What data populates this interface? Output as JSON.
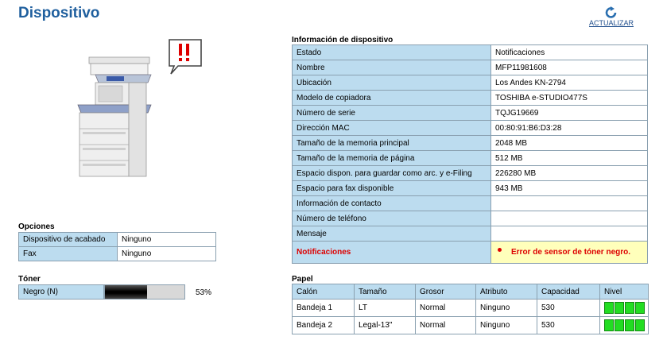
{
  "page": {
    "title": "Dispositivo"
  },
  "refresh": {
    "label": "ACTUALIZAR"
  },
  "device_info": {
    "section_label": "Información de dispositivo",
    "rows": [
      {
        "key": "Estado",
        "value": "Notificaciones"
      },
      {
        "key": "Nombre",
        "value": "MFP11981608"
      },
      {
        "key": "Ubicación",
        "value": "Los Andes KN-2794"
      },
      {
        "key": "Modelo de copiadora",
        "value": "TOSHIBA e-STUDIO477S"
      },
      {
        "key": "Número de serie",
        "value": "TQJG19669"
      },
      {
        "key": "Dirección MAC",
        "value": "00:80:91:B6:D3:28"
      },
      {
        "key": "Tamaño de la memoria principal",
        "value": "2048 MB"
      },
      {
        "key": "Tamaño de la memoria de página",
        "value": "512 MB"
      },
      {
        "key": "Espacio dispon. para guardar como arc. y e-Filing",
        "value": "226280 MB"
      },
      {
        "key": "Espacio para fax disponible",
        "value": "943 MB"
      },
      {
        "key": "Información de contacto",
        "value": ""
      },
      {
        "key": "Número de teléfono",
        "value": ""
      },
      {
        "key": "Mensaje",
        "value": ""
      }
    ],
    "notifications": {
      "key": "Notificaciones",
      "value": "Error de sensor de tóner negro."
    }
  },
  "options": {
    "section_label": "Opciones",
    "rows": [
      {
        "key": "Dispositivo de acabado",
        "value": "Ninguno"
      },
      {
        "key": "Fax",
        "value": "Ninguno"
      }
    ]
  },
  "toner": {
    "section_label": "Tóner",
    "name": "Negro (N)",
    "percent_label": "53%",
    "level_fraction": 0.53
  },
  "paper": {
    "section_label": "Papel",
    "headers": [
      "Calón",
      "Tamaño",
      "Grosor",
      "Atributo",
      "Capacidad",
      "Nivel"
    ],
    "rows": [
      {
        "tray": "Bandeja 1",
        "size": "LT",
        "thickness": "Normal",
        "attribute": "Ninguno",
        "capacity": "530",
        "level_bars": 4
      },
      {
        "tray": "Bandeja 2",
        "size": "Legal-13\"",
        "thickness": "Normal",
        "attribute": "Ninguno",
        "capacity": "530",
        "level_bars": 4
      }
    ]
  },
  "colors": {
    "title": "#1f5f9e",
    "key_bg": "#bcdcef",
    "alert": "#dd0000",
    "alert_bg": "#ffffbb",
    "level": "#22dd22"
  },
  "icons": {
    "refresh": "refresh-icon",
    "printer": "printer-image",
    "alert": "alert-bubble-icon"
  }
}
